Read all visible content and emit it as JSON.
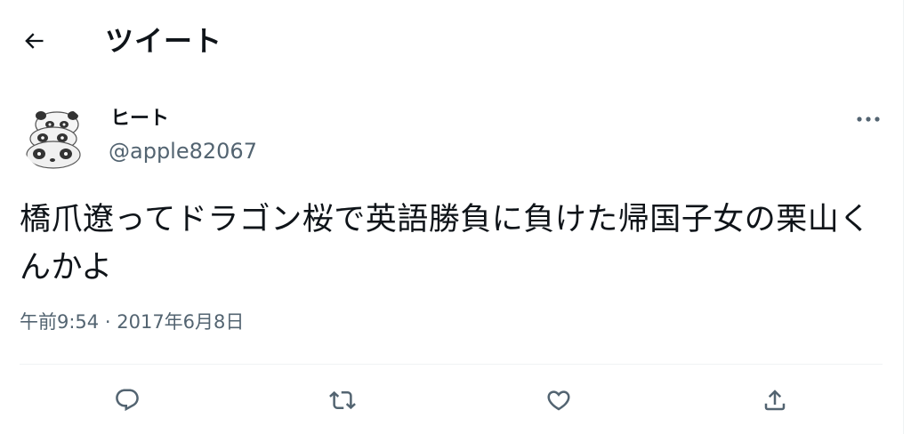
{
  "header": {
    "title": "ツイート",
    "back_icon": "arrow-left-icon"
  },
  "tweet": {
    "author": {
      "display_name": "ヒート",
      "handle": "@apple82067",
      "avatar_icon": "panda-avatar"
    },
    "text": "橋爪遼ってドラゴン桜で英語勝負に負けた帰国子女の栗山くんかよ",
    "time": "午前9:54",
    "separator": "·",
    "date": "2017年6月8日"
  },
  "actions": [
    {
      "icon": "reply-icon"
    },
    {
      "icon": "retweet-icon"
    },
    {
      "icon": "like-icon"
    },
    {
      "icon": "share-icon"
    }
  ],
  "colors": {
    "text_primary": "#0f1419",
    "text_secondary": "#536471",
    "divider": "#eff3f4"
  }
}
